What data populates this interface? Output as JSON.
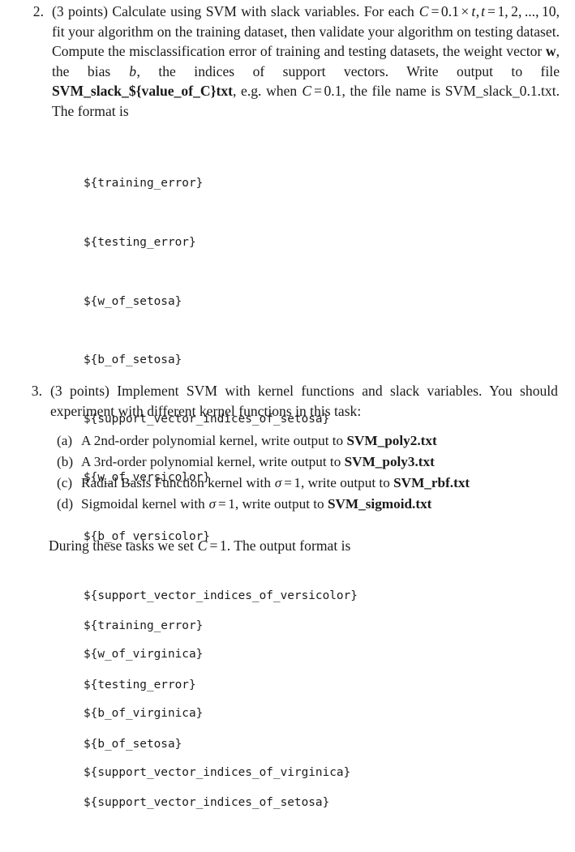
{
  "document": {
    "type": "homework-assignment-excerpt",
    "items": [
      {
        "number": "2.",
        "points_label": "(3 points)",
        "text_part_1": "Calculate using SVM with slack variables. For each ",
        "math_1": "C = 0.1 × t, t = 1, 2, ..., 10",
        "text_part_2": ", fit your algorithm on the training dataset, then validate your algorithm on testing dataset. Compute the misclassification error of training and testing datasets, the weight vector ",
        "bold_w": "w",
        "text_part_3": ", the bias ",
        "italic_b": "b",
        "text_part_4": ", the indices of support vectors. Write output to file ",
        "bold_filename": "SVM_slack_${value_of_C}txt",
        "text_part_5": ", e.g. when ",
        "math_2": "C = 0.1",
        "text_part_6": ", the file name is SVM_slack_0.1.txt. The format is",
        "code_lines": [
          "${training_error}",
          "${testing_error}",
          "${w_of_setosa}",
          "${b_of_setosa}",
          "${support_vector_indices_of_setosa}",
          "${w_of_versicolor}",
          "${b_of_versicolor}",
          "${support_vector_indices_of_versicolor}",
          "${w_of_virginica}",
          "${b_of_virginica}",
          "${support_vector_indices_of_virginica}"
        ]
      },
      {
        "number": "3.",
        "points_label": "(3 points)",
        "text": "Implement SVM with kernel functions and slack variables. You should experiment with different kernel functions in this task:",
        "subitems": [
          {
            "marker": "(a)",
            "text_before": "A 2nd-order polynomial kernel, write output to ",
            "filename": "SVM_poly2.txt"
          },
          {
            "marker": "(b)",
            "text_before": "A 3rd-order polynomial kernel, write output to ",
            "filename": "SVM_poly3.txt"
          },
          {
            "marker": "(c)",
            "text_before": "Radial Basis Function kernel with ",
            "math": "σ = 1",
            "text_middle": ", write output to ",
            "filename": "SVM_rbf.txt"
          },
          {
            "marker": "(d)",
            "text_before": "Sigmoidal kernel with ",
            "math": "σ = 1",
            "text_middle": ", write output to ",
            "filename": "SVM_sigmoid.txt"
          }
        ],
        "closing_text_before": "During these tasks we set ",
        "closing_math": "C = 1",
        "closing_text_after": ". The output format is",
        "code_lines": [
          "${training_error}",
          "${testing_error}",
          "${b_of_setosa}",
          "${support_vector_indices_of_setosa}"
        ]
      }
    ],
    "symbols": {
      "sigma": "σ",
      "times": "×",
      "equals": "=",
      "C": "C",
      "t": "t",
      "b": "b",
      "w": "w"
    },
    "values": {
      "C_base": "0.1",
      "t_list": "1, 2, ..., 10",
      "C_example": "0.1",
      "C_task3": "1",
      "sigma_value": "1",
      "example_filename": "SVM_slack_0.1.txt",
      "points": "3"
    }
  }
}
